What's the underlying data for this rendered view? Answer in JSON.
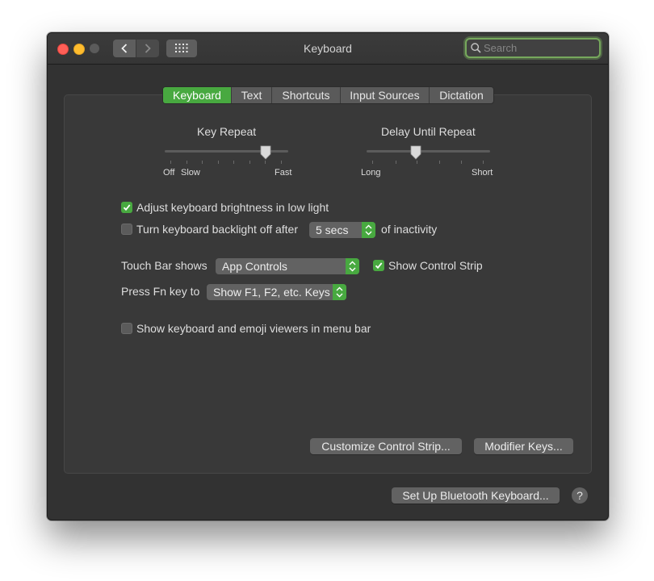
{
  "window": {
    "title": "Keyboard",
    "search_placeholder": "Search"
  },
  "tabs": [
    {
      "label": "Keyboard",
      "active": true
    },
    {
      "label": "Text",
      "active": false
    },
    {
      "label": "Shortcuts",
      "active": false
    },
    {
      "label": "Input Sources",
      "active": false
    },
    {
      "label": "Dictation",
      "active": false
    }
  ],
  "key_repeat": {
    "label": "Key Repeat",
    "min_label": "Off",
    "slow_label": "Slow",
    "max_label": "Fast",
    "value_fraction": 0.82
  },
  "delay_until_repeat": {
    "label": "Delay Until Repeat",
    "min_label": "Long",
    "max_label": "Short",
    "value_fraction": 0.4
  },
  "options": {
    "brightness_label": "Adjust keyboard brightness in low light",
    "brightness_checked": true,
    "backlight_label": "Turn keyboard backlight off after",
    "backlight_checked": false,
    "backlight_value": "5 secs",
    "backlight_suffix": "of inactivity",
    "touchbar_label": "Touch Bar shows",
    "touchbar_value": "App Controls",
    "control_strip_label": "Show Control Strip",
    "control_strip_checked": true,
    "fn_label": "Press Fn key to",
    "fn_value": "Show F1, F2, etc. Keys",
    "viewers_label": "Show keyboard and emoji viewers in menu bar",
    "viewers_checked": false
  },
  "buttons": {
    "customize": "Customize Control Strip...",
    "modifier": "Modifier Keys...",
    "bluetooth": "Set Up Bluetooth Keyboard...",
    "help": "?"
  },
  "colors": {
    "accent": "#48a940",
    "window_bg": "#323232",
    "control_bg": "#626262"
  }
}
